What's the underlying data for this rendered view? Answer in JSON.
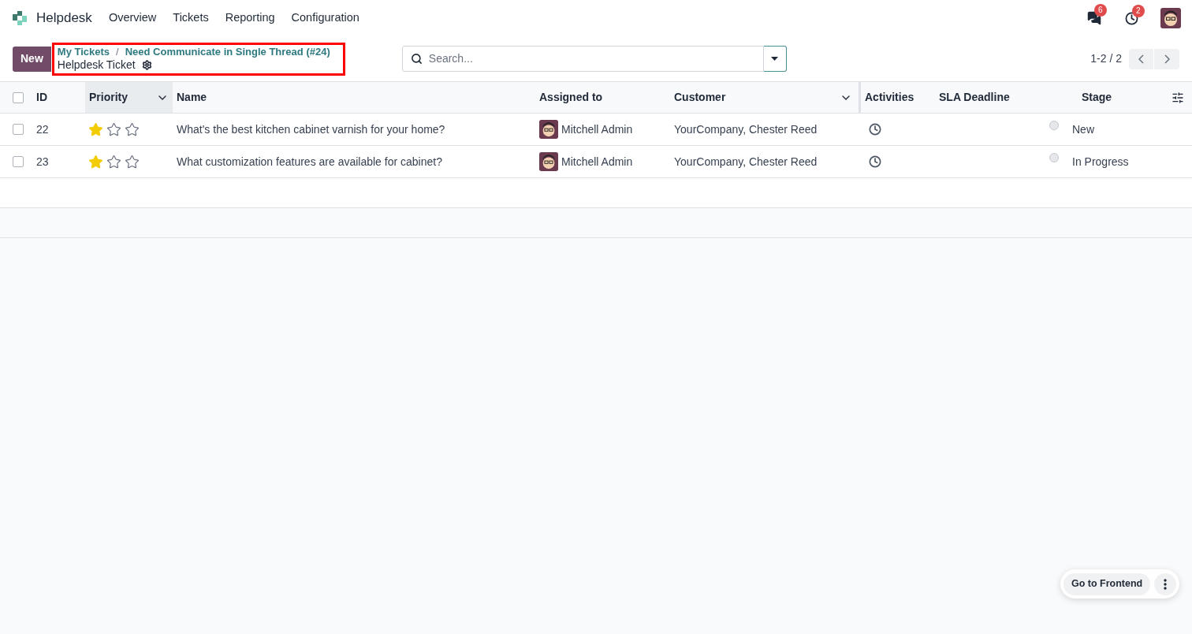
{
  "app": {
    "name": "Helpdesk"
  },
  "menu": [
    "Overview",
    "Tickets",
    "Reporting",
    "Configuration"
  ],
  "systray": {
    "messages_badge": "6",
    "activities_badge": "2"
  },
  "control_panel": {
    "new_button": "New",
    "breadcrumbs": [
      "My Tickets",
      "Need Communicate in Single Thread (#24)"
    ],
    "separator": "/",
    "current": "Helpdesk Ticket",
    "annotation_highlight": true,
    "search": {
      "placeholder": "Search..."
    },
    "pager": "1-2 / 2"
  },
  "table": {
    "select_all_checked": false,
    "columns": [
      "ID",
      "Priority",
      "Name",
      "Assigned to",
      "Customer",
      "Activities",
      "SLA Deadline",
      "Stage"
    ],
    "rows": [
      {
        "checked": false,
        "id": "22",
        "stars": 1,
        "name": "What's the best kitchen cabinet varnish for your home?",
        "assigned_to": "Mitchell Admin",
        "customer": "YourCompany, Chester Reed",
        "stage": "New"
      },
      {
        "checked": false,
        "id": "23",
        "stars": 1,
        "name": "What customization features are available for cabinet?",
        "assigned_to": "Mitchell Admin",
        "customer": "YourCompany, Chester Reed",
        "stage": "In Progress"
      }
    ]
  },
  "floating": {
    "button": "Go to Frontend"
  }
}
